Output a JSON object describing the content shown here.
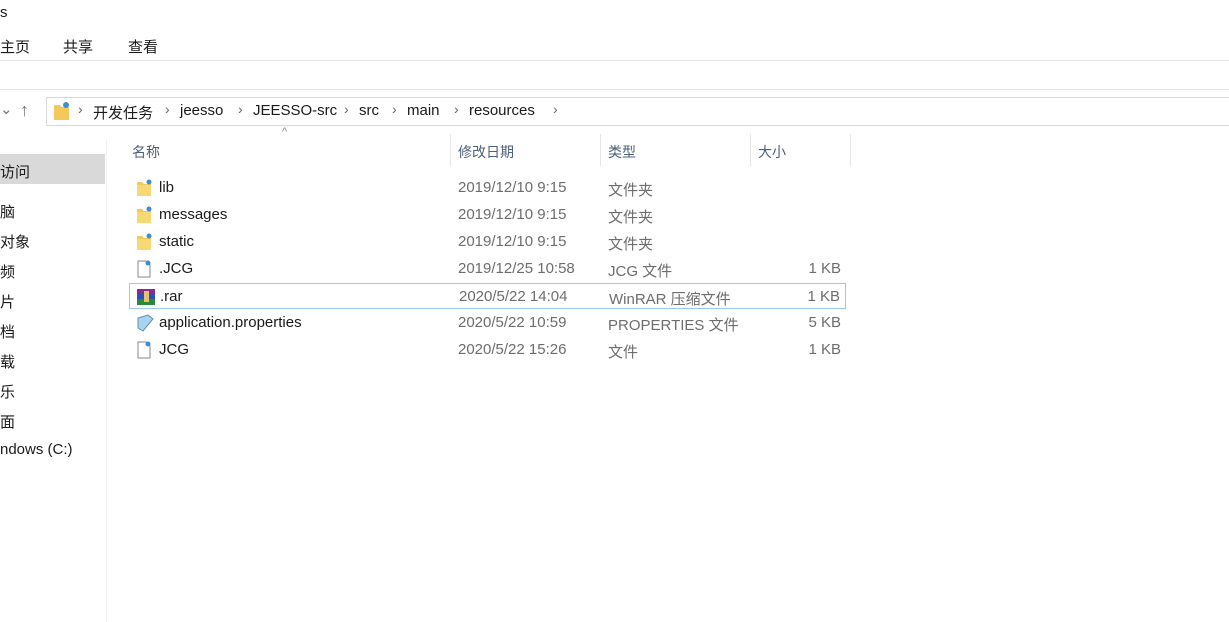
{
  "window": {
    "title": "s"
  },
  "ribbon": {
    "tabs": [
      "主页",
      "共享",
      "查看"
    ]
  },
  "nav": {
    "back": "⌄",
    "up": "↑"
  },
  "breadcrumb": [
    "开发任务",
    "jeesso",
    "JEESSO-src",
    "src",
    "main",
    "resources"
  ],
  "sidebar": {
    "items": [
      "访问",
      "脑",
      "对象",
      "频",
      "片",
      "档",
      "载",
      "乐",
      "面",
      "ndows (C:)"
    ]
  },
  "columns": {
    "name": "名称",
    "date": "修改日期",
    "type": "类型",
    "size": "大小"
  },
  "files": [
    {
      "name": "lib",
      "date": "2019/12/10 9:15",
      "type": "文件夹",
      "size": "",
      "icon": "folder"
    },
    {
      "name": "messages",
      "date": "2019/12/10 9:15",
      "type": "文件夹",
      "size": "",
      "icon": "folder"
    },
    {
      "name": "static",
      "date": "2019/12/10 9:15",
      "type": "文件夹",
      "size": "",
      "icon": "folder"
    },
    {
      "name": ".JCG",
      "date": "2019/12/25 10:58",
      "type": "JCG 文件",
      "size": "1 KB",
      "icon": "file"
    },
    {
      "name": ".rar",
      "date": "2020/5/22 14:04",
      "type": "WinRAR 压缩文件",
      "size": "1 KB",
      "icon": "rar"
    },
    {
      "name": "application.properties",
      "date": "2020/5/22 10:59",
      "type": "PROPERTIES 文件",
      "size": "5 KB",
      "icon": "properties"
    },
    {
      "name": "JCG",
      "date": "2020/5/22 15:26",
      "type": "文件",
      "size": "1 KB",
      "icon": "file"
    }
  ]
}
